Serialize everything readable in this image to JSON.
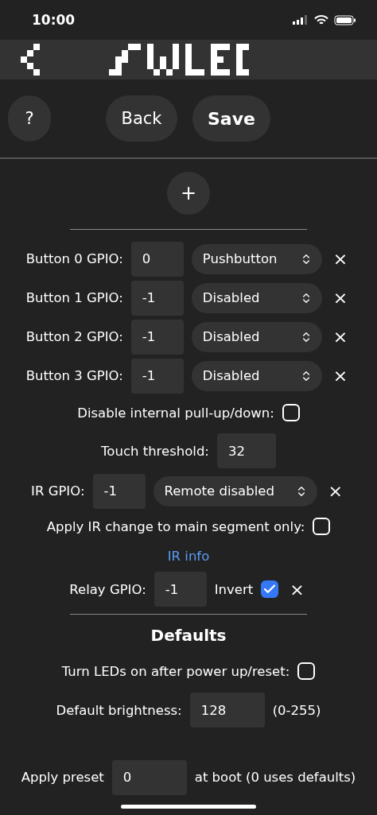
{
  "status_bar": {
    "time": "10:00"
  },
  "toolbar": {
    "help": "?",
    "back": "Back",
    "save": "Save"
  },
  "add_button": "+",
  "buttons": [
    {
      "label": "Button 0 GPIO:",
      "gpio": "0",
      "mode": "Pushbutton",
      "remove": "×"
    },
    {
      "label": "Button 1 GPIO:",
      "gpio": "-1",
      "mode": "Disabled",
      "remove": "×"
    },
    {
      "label": "Button 2 GPIO:",
      "gpio": "-1",
      "mode": "Disabled",
      "remove": "×"
    },
    {
      "label": "Button 3 GPIO:",
      "gpio": "-1",
      "mode": "Disabled",
      "remove": "×"
    }
  ],
  "pullup": {
    "label": "Disable internal pull-up/down:",
    "checked": false
  },
  "touch": {
    "label": "Touch threshold:",
    "value": "32"
  },
  "ir": {
    "label": "IR GPIO:",
    "gpio": "-1",
    "mode": "Remote disabled",
    "remove": "×"
  },
  "ir_main": {
    "label": "Apply IR change to main segment only:",
    "checked": false
  },
  "ir_info": "IR info",
  "relay": {
    "label": "Relay GPIO:",
    "gpio": "-1",
    "invert_label": "Invert",
    "invert": true,
    "remove": "×"
  },
  "defaults": {
    "title": "Defaults",
    "leds_on": {
      "label": "Turn LEDs on after power up/reset:",
      "checked": false
    },
    "brightness": {
      "label": "Default brightness:",
      "value": "128",
      "hint": "(0-255)"
    },
    "preset": {
      "label": "Apply preset",
      "value": "0",
      "suffix": "at boot (0 uses defaults)"
    }
  }
}
